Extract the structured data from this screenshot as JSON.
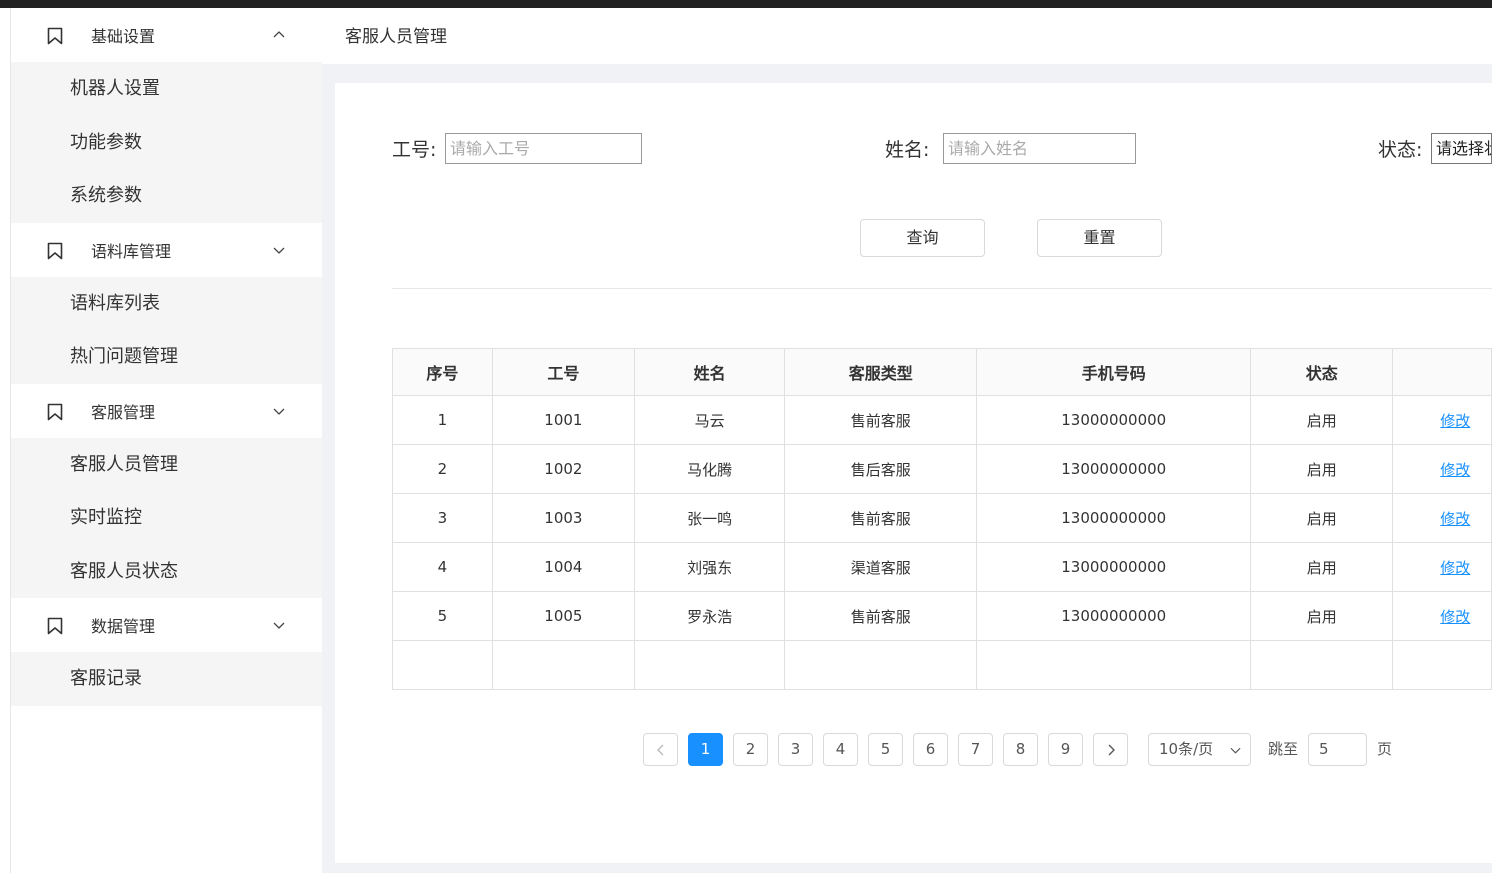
{
  "sidebar": {
    "groups": [
      {
        "title": "基础设置",
        "expanded": true,
        "items": [
          "机器人设置",
          "功能参数",
          "系统参数"
        ]
      },
      {
        "title": "语料库管理",
        "expanded": false,
        "items": [
          "语料库列表",
          "热门问题管理"
        ]
      },
      {
        "title": "客服管理",
        "expanded": false,
        "items": [
          "客服人员管理",
          "实时监控",
          "客服人员状态"
        ]
      },
      {
        "title": "数据管理",
        "expanded": false,
        "items": [
          "客服记录"
        ]
      }
    ]
  },
  "breadcrumb": "客服人员管理",
  "filters": {
    "job_no_label": "工号:",
    "job_no_placeholder": "请输入工号",
    "name_label": "姓名:",
    "name_placeholder": "请输入姓名",
    "status_label": "状态:",
    "status_value": "请选择状态"
  },
  "buttons": {
    "query": "查询",
    "reset": "重置"
  },
  "table": {
    "headers": [
      "序号",
      "工号",
      "姓名",
      "客服类型",
      "手机号码",
      "状态",
      ""
    ],
    "rows": [
      [
        "1",
        "1001",
        "马云",
        "售前客服",
        "13000000000",
        "启用",
        "修改"
      ],
      [
        "2",
        "1002",
        "马化腾",
        "售后客服",
        "13000000000",
        "启用",
        "修改"
      ],
      [
        "3",
        "1003",
        "张一鸣",
        "售前客服",
        "13000000000",
        "启用",
        "修改"
      ],
      [
        "4",
        "1004",
        "刘强东",
        "渠道客服",
        "13000000000",
        "启用",
        "修改"
      ],
      [
        "5",
        "1005",
        "罗永浩",
        "售前客服",
        "13000000000",
        "启用",
        "修改"
      ],
      [
        "",
        "",
        "",
        "",
        "",
        "",
        ""
      ]
    ]
  },
  "pagination": {
    "prev": "<",
    "next": ">",
    "pages": [
      "1",
      "2",
      "3",
      "4",
      "5",
      "6",
      "7",
      "8",
      "9"
    ],
    "current": "1",
    "page_size": "10条/页",
    "jump_label": "跳至",
    "jump_value": "5",
    "page_suffix": "页"
  },
  "colors": {
    "accent": "#1890ff"
  }
}
